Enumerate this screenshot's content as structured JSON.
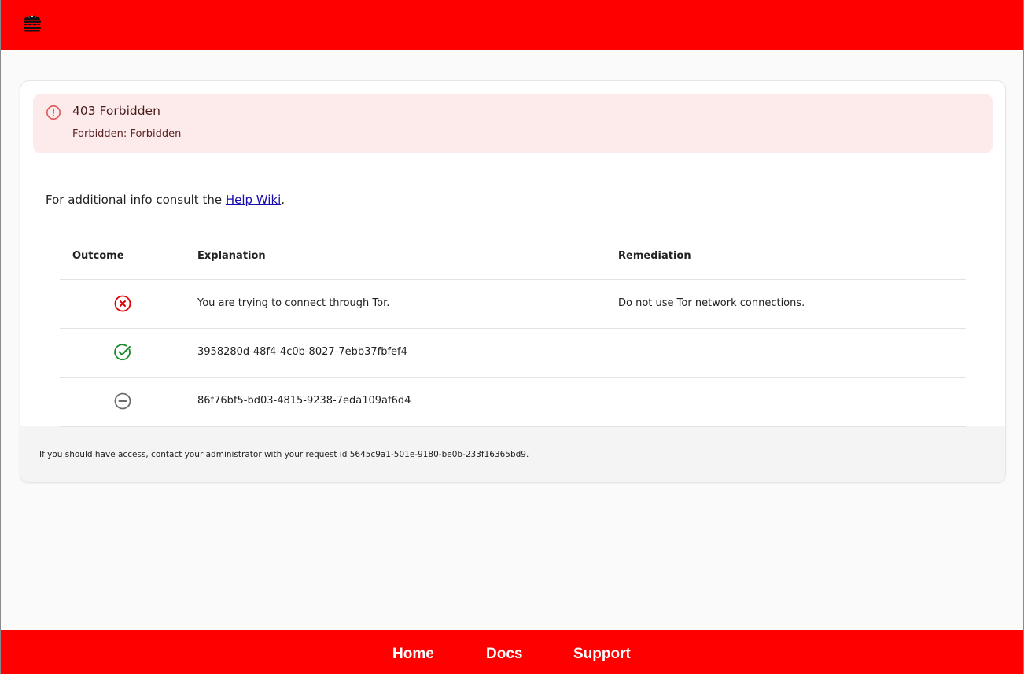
{
  "header": {
    "logo_icon": "burger-icon",
    "brand_color": "#ff0000"
  },
  "alert": {
    "icon": "alert-circle-icon",
    "title": "403 Forbidden",
    "message": "Forbidden: Forbidden"
  },
  "info": {
    "prefix": "For additional info consult the ",
    "link_label": "Help Wiki",
    "suffix": "."
  },
  "table": {
    "headers": {
      "outcome": "Outcome",
      "explanation": "Explanation",
      "remediation": "Remediation"
    },
    "rows": [
      {
        "outcome_icon": "x-circle-icon",
        "outcome_color": "#e00000",
        "explanation": "You are trying to connect through Tor.",
        "remediation": "Do not use Tor network connections."
      },
      {
        "outcome_icon": "check-circle-icon",
        "outcome_color": "#1a8a2a",
        "explanation": "3958280d-48f4-4c0b-8027-7ebb37fbfef4",
        "remediation": ""
      },
      {
        "outcome_icon": "minus-circle-icon",
        "outcome_color": "#6b6b6b",
        "explanation": "86f76bf5-bd03-4815-9238-7eda109af6d4",
        "remediation": ""
      }
    ]
  },
  "footer_note": "If you should have access, contact your administrator with your request id 5645c9a1-501e-9180-be0b-233f16365bd9.",
  "nav": {
    "home": "Home",
    "docs": "Docs",
    "support": "Support"
  }
}
